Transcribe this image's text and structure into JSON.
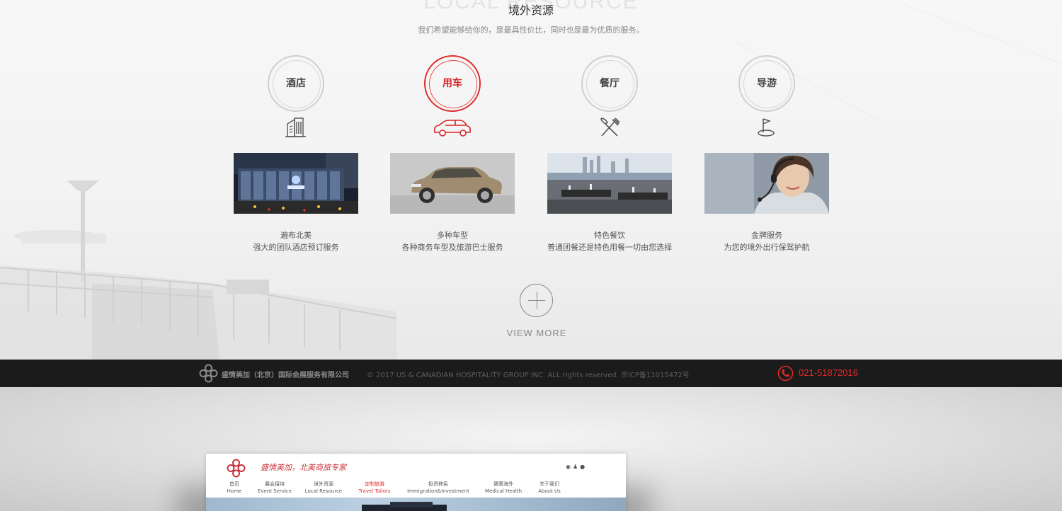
{
  "section": {
    "watermark_en": "LOCAL RESOURCE",
    "title": "境外资源",
    "subtitle": "我们希望能够给你的，是最具性价比，同时也是最为优质的服务。"
  },
  "columns": [
    {
      "label": "酒店",
      "icon": "building-icon",
      "caption1": "遍布北美",
      "caption2": "强大的团队酒店预订服务",
      "active": false
    },
    {
      "label": "用车",
      "icon": "car-icon",
      "caption1": "多种车型",
      "caption2": "各种商务车型及旅游巴士服务",
      "active": true
    },
    {
      "label": "餐厅",
      "icon": "fork-knife-icon",
      "caption1": "特色餐饮",
      "caption2": "普通团餐还是特色用餐一切由您选择",
      "active": false
    },
    {
      "label": "导游",
      "icon": "guide-flag-icon",
      "caption1": "金牌服务",
      "caption2": "为您的境外出行保驾护航",
      "active": false
    }
  ],
  "view_more": "VIEW  MORE",
  "footer": {
    "company": "盛情美加（北京）国际会展服务有限公司",
    "copyright": "© 2017 US & CANADIAN HOSPITALITY GROUP INC. ALL rights reserved. 京ICP备11015472号",
    "phone": "021-51872016"
  },
  "mockup": {
    "slogan": "盛情美加，北美商旅专家",
    "social_icons": [
      "weibo-icon",
      "qq-icon",
      "wechat-icon"
    ],
    "nav": [
      {
        "cn": "首页",
        "en": "Home"
      },
      {
        "cn": "展会接待",
        "en": "Event Service"
      },
      {
        "cn": "境外资源",
        "en": "Local Resource"
      },
      {
        "cn": "定制旅游",
        "en": "Travel Tailors"
      },
      {
        "cn": "投资移民",
        "en": "Immigration&Investment"
      },
      {
        "cn": "健康海外",
        "en": "Medical Health"
      },
      {
        "cn": "关于我们",
        "en": "About Us"
      }
    ],
    "active_nav_index": 3
  },
  "colors": {
    "accent": "#e02a2a",
    "footer_bg": "#1b1b1b",
    "text": "#555555"
  }
}
